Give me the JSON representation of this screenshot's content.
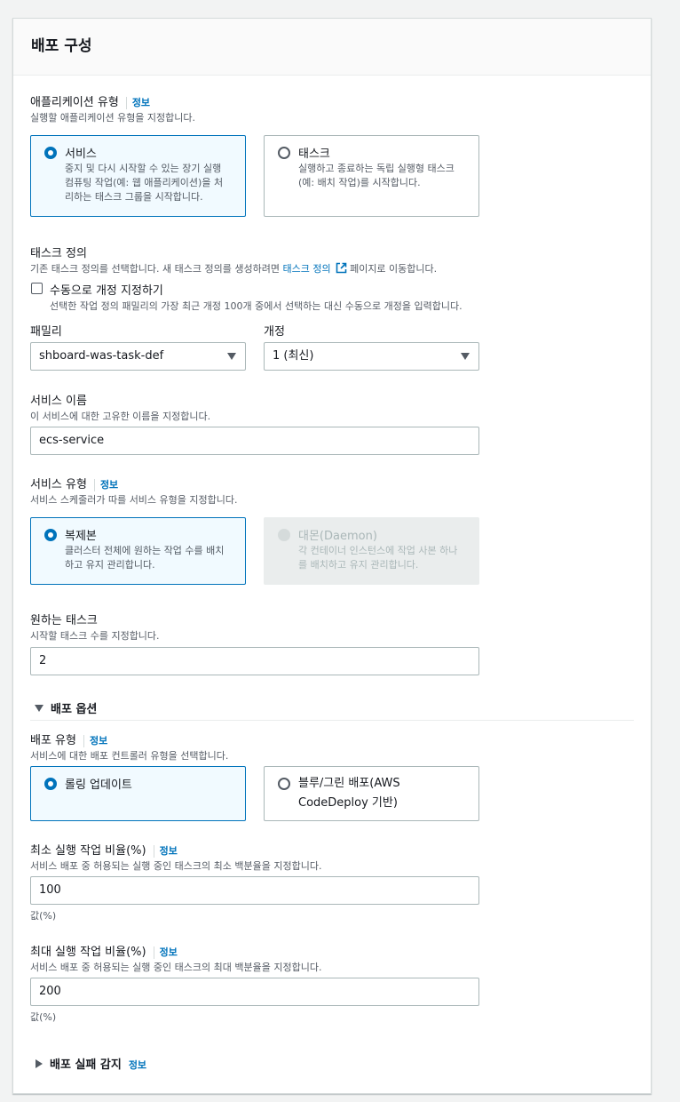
{
  "section": {
    "title": "배포 구성"
  },
  "app_type": {
    "label": "애플리케이션 유형",
    "info": "정보",
    "desc": "실행할 애플리케이션 유형을 지정합니다.",
    "options": [
      {
        "title": "서비스",
        "desc": [
          "중지 및 다시 시작할 수 있는 장기 실행",
          "컴퓨팅 작업(예: 웹 애플리케이션)을 처",
          "리하는 태스크 그룹을 시작합니다."
        ],
        "selected": true
      },
      {
        "title": "태스크",
        "desc": [
          "실행하고 종료하는 독립 실행형 태스크",
          "(예: 배치 작업)를 시작합니다."
        ],
        "selected": false
      }
    ]
  },
  "task_def": {
    "label": "태스크 정의",
    "desc_before": "기존 태스크 정의를 선택합니다. 새 태스크 정의를 생성하려면 ",
    "desc_link": "태스크 정의",
    "desc_after": " 페이지로 이동합니다.",
    "manual_checkbox_label": "수동으로 개정 지정하기",
    "manual_checkbox_desc": "선택한 작업 정의 패밀리의 가장 최근 개정 100개 중에서 선택하는 대신 수동으로 개정을 입력합니다.",
    "manual_checked": false,
    "family_label": "패밀리",
    "family_value": "shboard-was-task-def",
    "revision_label": "개정",
    "revision_value": "1 (최신)"
  },
  "service_name": {
    "label": "서비스 이름",
    "desc": "이 서비스에 대한 고유한 이름을 지정합니다.",
    "value": "ecs-service"
  },
  "service_type": {
    "label": "서비스 유형",
    "info": "정보",
    "desc": "서비스 스케줄러가 따를 서비스 유형을 지정합니다.",
    "options": [
      {
        "title": "복제본",
        "desc": [
          "클러스터 전체에 원하는 작업 수를 배치",
          "하고 유지 관리합니다."
        ],
        "selected": true,
        "disabled": false
      },
      {
        "title": "대몬(Daemon)",
        "desc": [
          "각 컨테이너 인스턴스에 작업 사본 하나",
          "를 배치하고 유지 관리합니다."
        ],
        "selected": false,
        "disabled": true
      }
    ]
  },
  "desired_tasks": {
    "label": "원하는 태스크",
    "desc": "시작할 태스크 수를 지정합니다.",
    "value": "2"
  },
  "deploy_options": {
    "expander_label": "배포 옵션",
    "expanded": true,
    "type_label": "배포 유형",
    "type_info": "정보",
    "type_desc": "서비스에 대한 배포 컨트롤러 유형을 선택합니다.",
    "type_options": [
      {
        "title": "롤링 업데이트",
        "title2": "",
        "selected": true
      },
      {
        "title": "블루/그린 배포(AWS",
        "title2": "CodeDeploy 기반)",
        "selected": false
      }
    ],
    "min_label": "최소 실행 작업 비율(%)",
    "min_info": "정보",
    "min_desc": "서비스 배포 중 허용되는 실행 중인 태스크의 최소 백분율을 지정합니다.",
    "min_value": "100",
    "min_unit": "값(%)",
    "max_label": "최대 실행 작업 비율(%)",
    "max_info": "정보",
    "max_desc": "서비스 배포 중 허용되는 실행 중인 태스크의 최대 백분율을 지정합니다.",
    "max_value": "200",
    "max_unit": "값(%)"
  },
  "failure_detection": {
    "expander_label": "배포 실패 감지",
    "info": "정보",
    "expanded": false
  },
  "colors": {
    "accent": "#0073bb",
    "selected_bg": "#f1faff",
    "border": "#aab7b8"
  }
}
